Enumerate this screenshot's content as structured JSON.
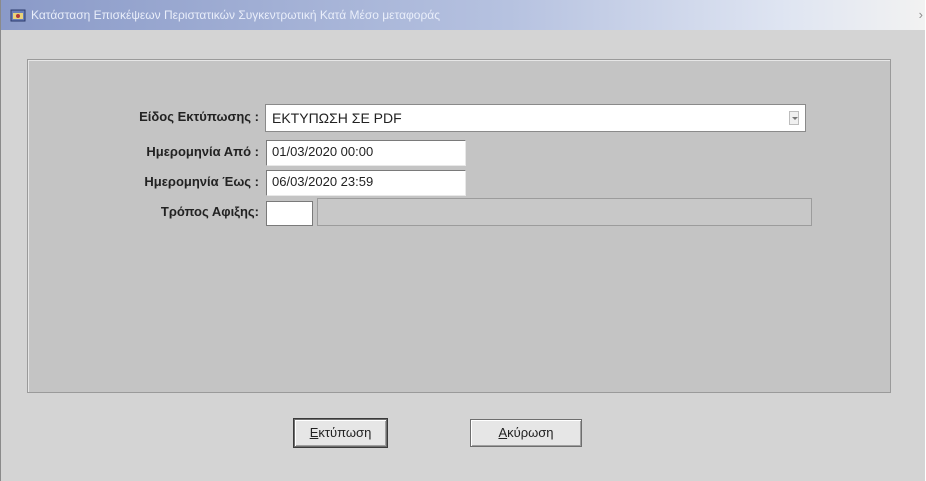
{
  "window": {
    "title": "Κατάσταση Επισκέψεων Περιστατικών Συγκεντρωτική Κατά Μέσο μεταφοράς"
  },
  "form": {
    "print_type_label": "Είδος Εκτύπωσης :",
    "print_type_value": "ΕΚΤΥΠΩΣΗ ΣΕ PDF",
    "date_from_label": "Ημερομηνία Από :",
    "date_from_value": "01/03/2020 00:00",
    "date_to_label": "Ημερομηνία Έως :",
    "date_to_value": "06/03/2020 23:59",
    "arrival_mode_label": "Τρόπος Αφιξης:",
    "arrival_mode_code": "",
    "arrival_mode_desc": ""
  },
  "buttons": {
    "print_mnemonic": "Ε",
    "print_rest": "κτύπωση",
    "cancel_mnemonic": "Α",
    "cancel_rest": "κύρωση"
  },
  "icons": {
    "app": "oracle-forms-window-icon",
    "dropdown": "chevron-down-icon",
    "close": "close-icon"
  }
}
